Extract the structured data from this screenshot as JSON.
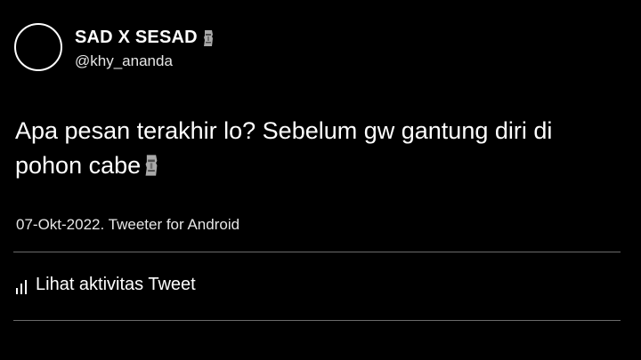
{
  "user": {
    "display_name": "SAD X SESAD",
    "name_emoji": "moai-icon",
    "handle": "@khy_ananda"
  },
  "tweet": {
    "text": "Apa pesan terakhir lo? Sebelum gw gantung diri di pohon cabe",
    "text_emoji": "moai-icon"
  },
  "meta": {
    "date_source": "07-Okt-2022. Tweeter for Android"
  },
  "actions": {
    "activity_label": "Lihat aktivitas Tweet",
    "activity_icon": "bar-chart-icon"
  },
  "colors": {
    "background": "#000000",
    "text": "#ffffff",
    "secondary_text": "#e6e6e6",
    "divider": "#6a6a6a"
  }
}
